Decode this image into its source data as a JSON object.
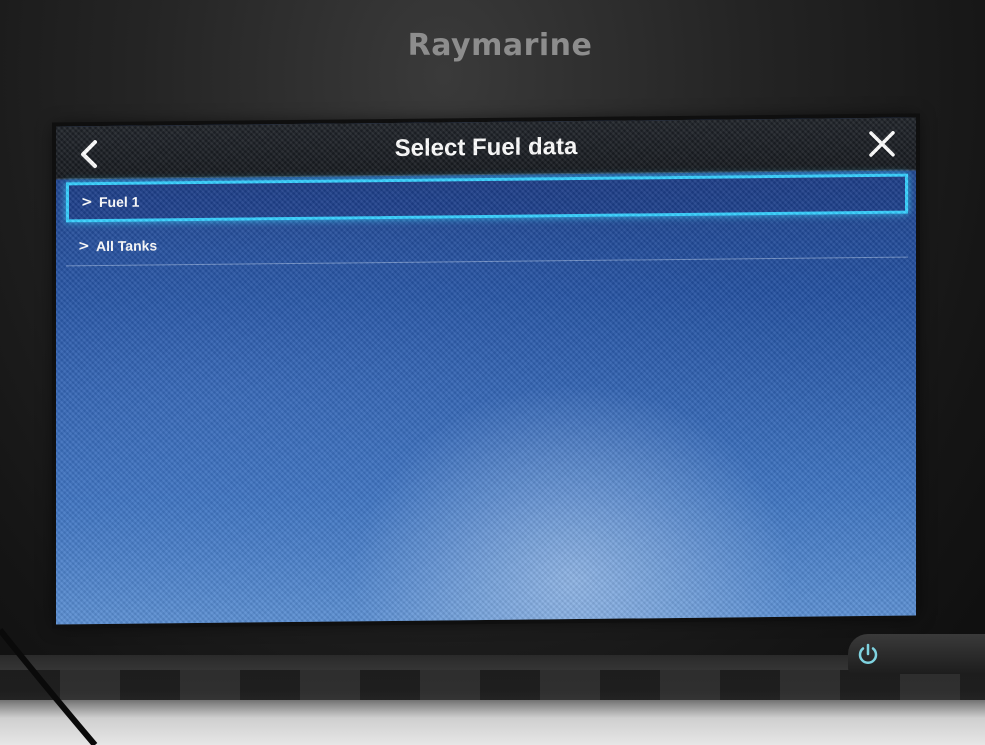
{
  "brand": "Raymarine",
  "header": {
    "title": "Select Fuel data",
    "back_icon": "chevron-left-icon",
    "close_icon": "close-icon"
  },
  "list": {
    "items": [
      {
        "label": "Fuel 1",
        "icon": "chevron-right-icon",
        "selected": true
      },
      {
        "label": "All Tanks",
        "icon": "chevron-right-icon",
        "selected": false
      }
    ]
  },
  "colors": {
    "accent_selection": "#36d0ff",
    "screen_blue": "#2350a0",
    "titlebar": "#1e2228"
  },
  "hardware": {
    "power_icon": "power-icon"
  }
}
